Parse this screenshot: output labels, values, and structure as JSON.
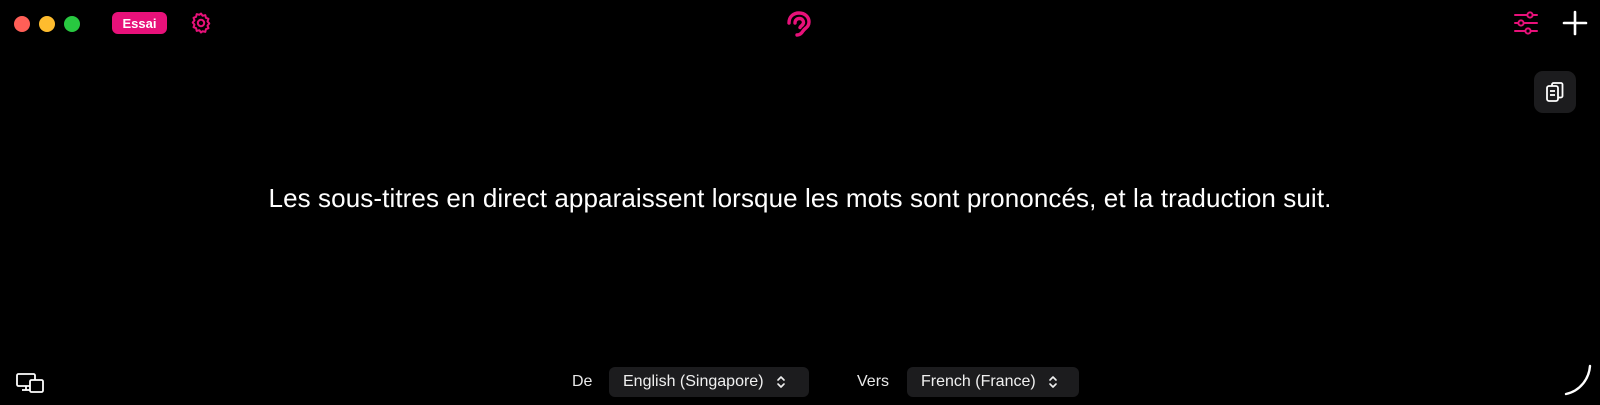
{
  "titlebar": {
    "trial_badge": "Essai",
    "icons": {
      "settings": "gear-icon",
      "logo": "ear-icon",
      "adjust": "sliders-icon",
      "new": "plus-icon",
      "copy": "copy-icon",
      "screens": "screens-icon",
      "loader": "spinner-arc-icon"
    }
  },
  "caption": {
    "text": "Les sous-titres en direct apparaissent lorsque les mots sont prononcés, et la traduction suit."
  },
  "languages": {
    "from_label": "De",
    "from_value": "English (Singapore)",
    "to_label": "Vers",
    "to_value": "French (France)"
  },
  "colors": {
    "accent": "#e8117a",
    "background": "#000000",
    "control_bg": "#1c1c1e"
  }
}
